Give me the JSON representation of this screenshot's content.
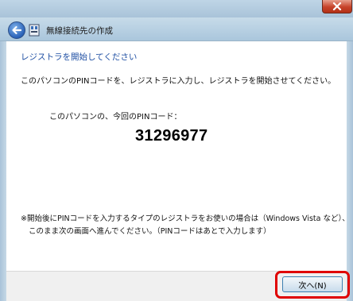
{
  "window": {
    "title": "無線接続先の作成"
  },
  "colors": {
    "heading": "#1f4fa3",
    "highlight": "#e00000",
    "close_button": "#c7432a"
  },
  "icons": {
    "back": "back-arrow-icon",
    "network": "network-icon",
    "close": "close-icon"
  },
  "main": {
    "heading": "レジストラを開始してください",
    "instruction": "このパソコンのPINコードを、レジストラに入力し、レジストラを開始させてください。",
    "pin_label": "このパソコンの、今回のPINコード：",
    "pin_value": "31296977",
    "note_line1": "※開始後にPINコードを入力するタイプのレジストラをお使いの場合は（Windows Vista など）、",
    "note_line2": "このまま次の画面へ進んでください。（PINコードはあとで入力します）"
  },
  "footer": {
    "next_label": "次へ(N)"
  }
}
